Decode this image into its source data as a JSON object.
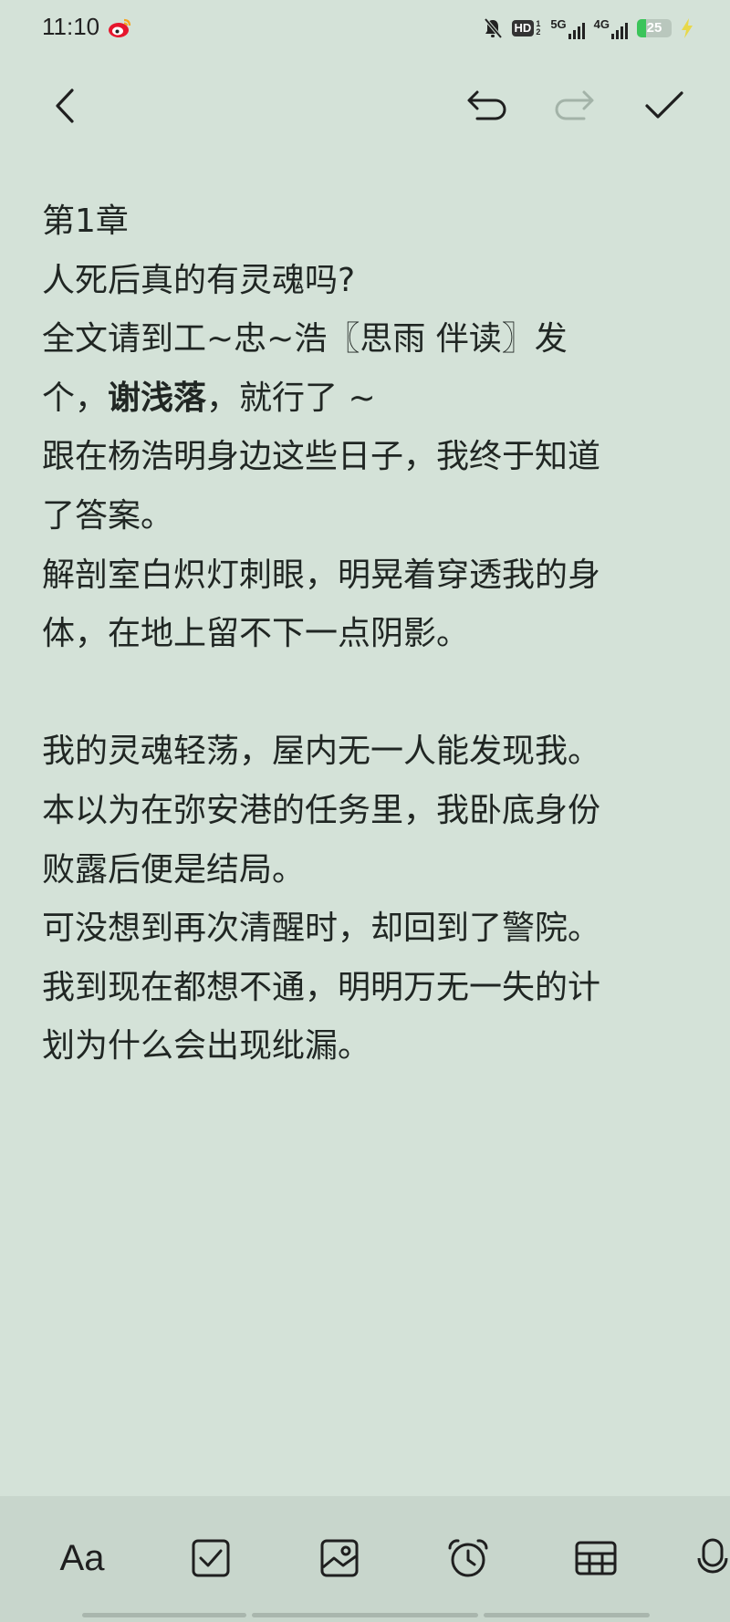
{
  "status_bar": {
    "time": "11:10",
    "hd_label": "HD",
    "hd_sub": "1 2",
    "net1_label": "5G",
    "net2_label": "4G",
    "battery_level": "25",
    "battery_fraction": 0.25,
    "battery_color": "#3bc45a",
    "icons": [
      "weibo-icon",
      "mute-bell-icon",
      "hd-icon",
      "signal-5g-icon",
      "signal-4g-icon",
      "battery-icon",
      "charging-bolt-icon"
    ]
  },
  "toolbar": {
    "icons": [
      "back-arrow-icon",
      "undo-icon",
      "redo-icon",
      "checkmark-icon"
    ]
  },
  "note": {
    "lines": [
      "第1章",
      "人死后真的有灵魂吗?",
      "全文请到工~忠~浩〖思雨 伴读〗发",
      {
        "pre": "个，",
        "bold": "谢浅落",
        "post": "，就行了 ~"
      },
      "跟在杨浩明身边这些日子，我终于知道",
      "了答案。",
      "解剖室白炽灯刺眼，明晃着穿透我的身",
      "体，在地上留不下一点阴影。",
      "",
      "我的灵魂轻荡，屋内无一人能发现我。",
      "本以为在弥安港的任务里，我卧底身份",
      "败露后便是结局。",
      "可没想到再次清醒时，却回到了警院。",
      "我到现在都想不通，明明万无一失的计",
      "划为什么会出现纰漏。"
    ]
  },
  "bottom_bar": {
    "format_label": "Aa",
    "icons": [
      "text-format-icon",
      "checkbox-icon",
      "image-icon",
      "alarm-clock-icon",
      "table-icon",
      "microphone-icon"
    ]
  }
}
